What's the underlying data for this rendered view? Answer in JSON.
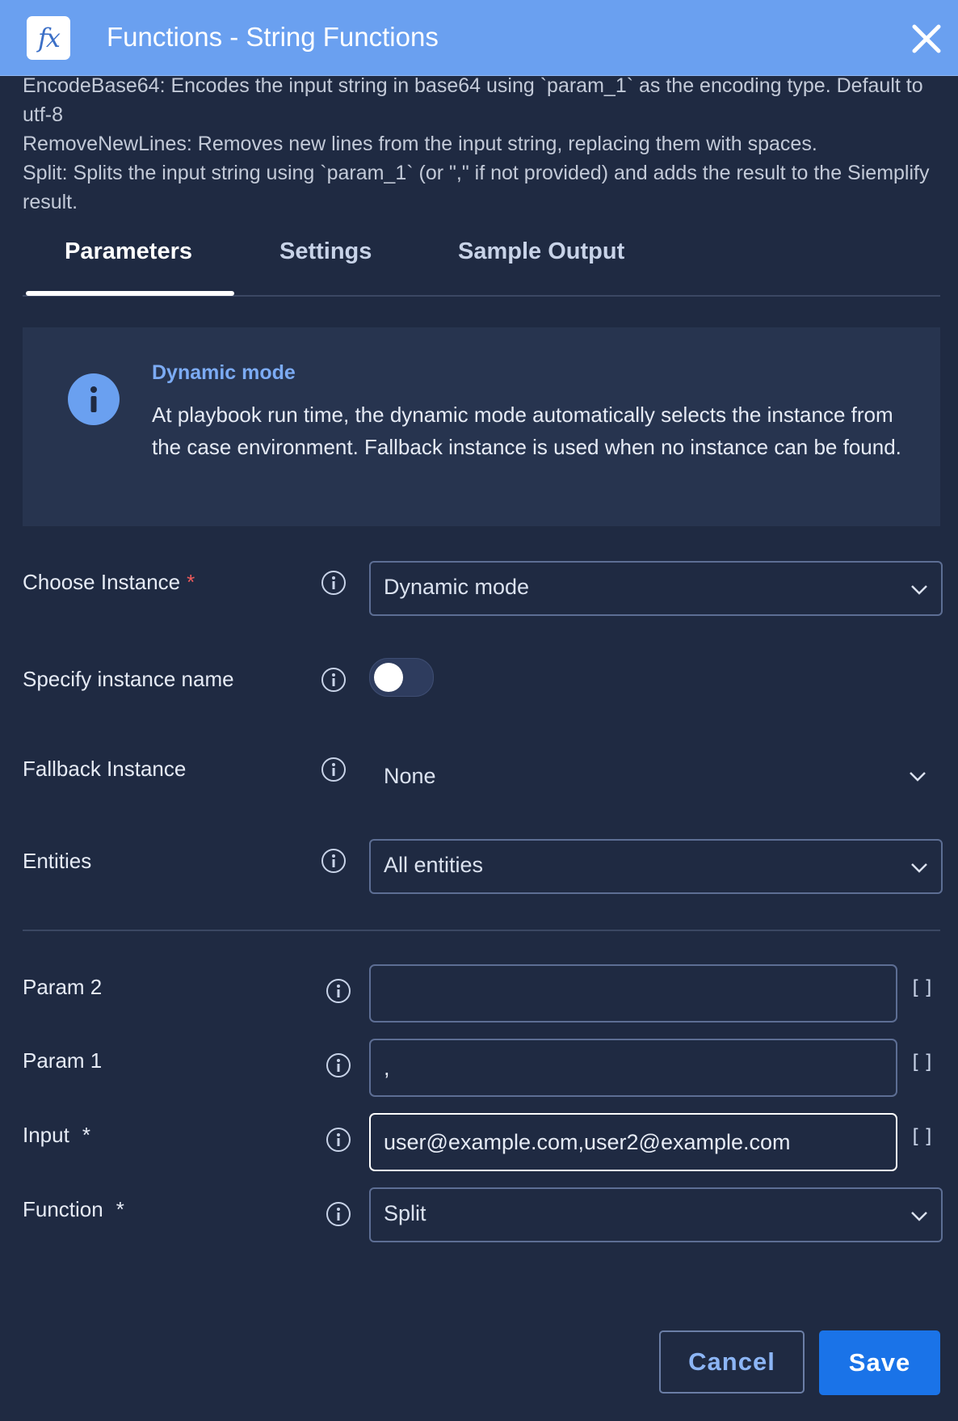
{
  "header": {
    "logo_text": "fx",
    "title": "Functions - String Functions"
  },
  "description": [
    "EncodeBase64: Encodes the input string in base64 using `param_1` as the encoding type. Default to utf-8",
    "RemoveNewLines: Removes new lines from the input string, replacing them with spaces.",
    "Split: Splits the input string using `param_1` (or \",\" if not provided) and adds the result to the Siemplify result."
  ],
  "tabs": [
    {
      "label": "Parameters",
      "active": true
    },
    {
      "label": "Settings",
      "active": false
    },
    {
      "label": "Sample Output",
      "active": false
    }
  ],
  "info_box": {
    "title": "Dynamic mode",
    "text": "At playbook run time, the dynamic mode automatically selects the instance from the case environment. Fallback instance is used when no instance can be found."
  },
  "fields": {
    "choose_instance": {
      "label": "Choose Instance",
      "required_mark": "*",
      "value": "Dynamic mode"
    },
    "specify_instance_name": {
      "label": "Specify instance name",
      "toggle_on": false
    },
    "fallback_instance": {
      "label": "Fallback Instance",
      "value": "None"
    },
    "entities": {
      "label": "Entities",
      "value": "All entities"
    },
    "param_2": {
      "label": "Param 2",
      "value": "",
      "bracket": "[]"
    },
    "param_1": {
      "label": "Param 1",
      "value": ",",
      "bracket": "[]"
    },
    "input": {
      "label": "Input",
      "required_mark": "*",
      "value": "user@example.com,user2@example.com",
      "bracket": "[]"
    },
    "function": {
      "label": "Function",
      "required_mark": "*",
      "value": "Split"
    }
  },
  "buttons": {
    "cancel": "Cancel",
    "save": "Save"
  },
  "colors": {
    "header_bg": "#6aa0f0",
    "page_bg": "#1f2a42",
    "info_box_bg": "#27344f",
    "accent": "#1a73e8",
    "required": "#ef5b5b"
  }
}
